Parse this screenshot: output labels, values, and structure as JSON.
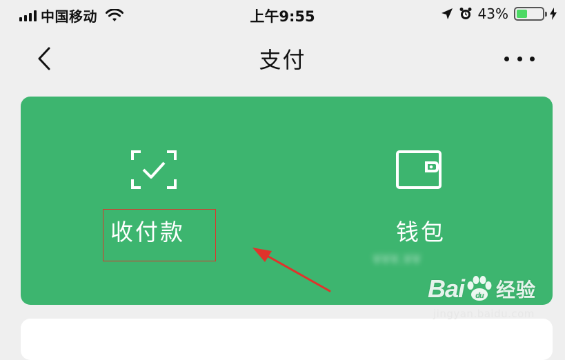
{
  "status_bar": {
    "carrier": "中国移动",
    "time": "上午9:55",
    "battery_percent": "43%",
    "battery_level": 0.43,
    "icons": [
      "signal-icon",
      "wifi-icon",
      "location-icon",
      "alarm-icon",
      "battery-icon",
      "charging-icon"
    ]
  },
  "nav": {
    "back_icon": "chevron-left-icon",
    "title": "支付",
    "more_icon": "more-horizontal-icon"
  },
  "pay_card": {
    "background": "#3db56f",
    "items": [
      {
        "label": "收付款",
        "icon": "scan-check-icon"
      },
      {
        "label": "钱包",
        "icon": "wallet-icon",
        "balance": "¥¥¥.¥¥"
      }
    ]
  },
  "annotation": {
    "highlight_color": "#e0332b",
    "arrow_color": "#e0332b"
  },
  "watermark": {
    "brand": "Bai",
    "brand_suffix": "du",
    "cn": "经验",
    "url": "jingyan.baidu.com"
  }
}
